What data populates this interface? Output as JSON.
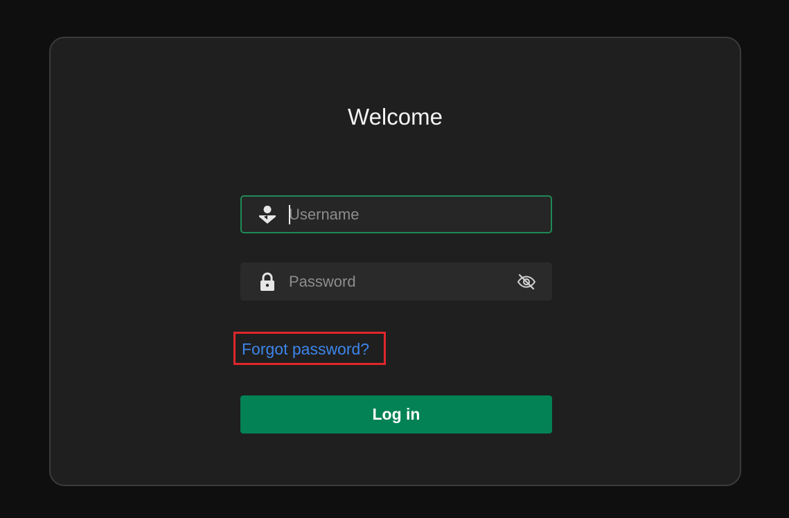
{
  "login": {
    "title": "Welcome",
    "username": {
      "placeholder": "Username",
      "value": ""
    },
    "password": {
      "placeholder": "Password",
      "value": ""
    },
    "forgot_password_label": "Forgot password?",
    "login_button_label": "Log in"
  },
  "colors": {
    "page_background": "#0f0f0f",
    "card_background": "#1f1f1f",
    "focus_border": "#1f8a58",
    "link": "#3d86ea",
    "primary_button": "#038256",
    "highlight_box": "#e0262c"
  },
  "icons": {
    "username": "user-icon",
    "password": "lock-icon",
    "toggle_visibility": "eye-off-icon"
  }
}
